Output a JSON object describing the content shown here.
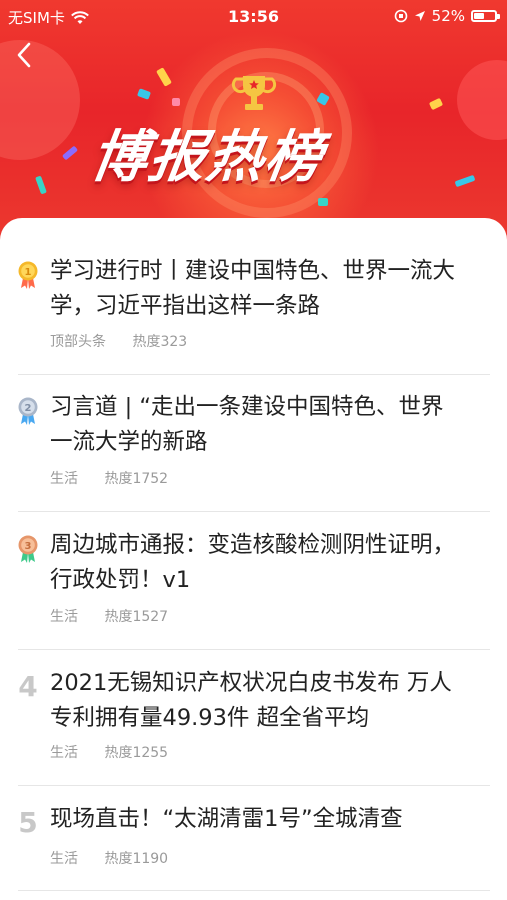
{
  "status_bar": {
    "carrier": "无SIM卡",
    "time": "13:56",
    "battery": "52%",
    "battery_level": 0.52
  },
  "header": {
    "title": "博报热榜",
    "back_icon": "chevron-left-icon",
    "trophy_icon": "trophy-icon",
    "colors": {
      "background": "#e8252a",
      "accent": "#f5c542"
    }
  },
  "hot_list": [
    {
      "rank": "1",
      "title_line1": "学习进行时丨建设中国特色、世界一流大",
      "title_line2": "学，习近平指出这样一条路",
      "category": "顶部头条",
      "heat": "热度323",
      "badge": "gold-medal-icon"
    },
    {
      "rank": "2",
      "title_line1": "习言道 | “走出一条建设中国特色、世界",
      "title_line2": "一流大学的新路",
      "category": "生活",
      "heat": "热度1752",
      "badge": "silver-medal-icon"
    },
    {
      "rank": "3",
      "title_line1": "周边城市通报：变造核酸检测阴性证明，",
      "title_line2": "行政处罚！v1",
      "category": "生活",
      "heat": "热度1527",
      "badge": "bronze-medal-icon"
    },
    {
      "rank": "4",
      "title_line1": "2021无锡知识产权状况白皮书发布 万人",
      "title_line2": "专利拥有量49.93件 超全省平均",
      "category": "生活",
      "heat": "热度1255"
    },
    {
      "rank": "5",
      "title_line1": "现场直击！“太湖清雷1号”全城清查",
      "title_line2": "",
      "category": "生活",
      "heat": "热度1190"
    }
  ]
}
